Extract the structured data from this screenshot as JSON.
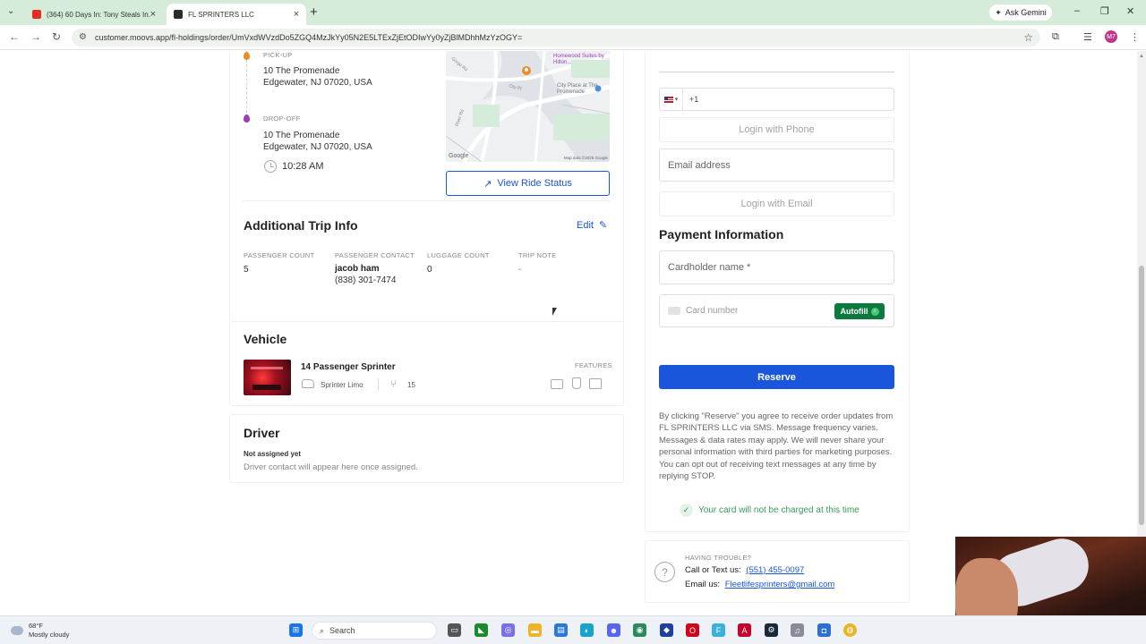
{
  "browser": {
    "tabs": [
      {
        "title": "(364) 60 Days In: Tony Steals In...",
        "active": false,
        "favicon_color": "#e52d27"
      },
      {
        "title": "FL SPRINTERS LLC",
        "active": true,
        "favicon_color": "#2b2b2b"
      }
    ],
    "gemini_label": "Ask Gemini",
    "url": "customer.moovs.app/fl-holdings/order/UmVxdWVzdDo5ZGQ4MzJkYy05N2E5LTExZjEtODIwYy0yZjBlMDhhMzYzOGY=",
    "profile_initials": "M7"
  },
  "trip": {
    "pickup_label": "PICK-UP",
    "pickup_address_line1": "10 The Promenade",
    "pickup_address_line2": "Edgewater, NJ 07020, USA",
    "dropoff_label": "DROP-OFF",
    "dropoff_address_line1": "10 The Promenade",
    "dropoff_address_line2": "Edgewater, NJ 07020, USA",
    "time": "10:28 AM",
    "view_ride_status": "View Ride Status",
    "map_labels": {
      "hotel": "Homewood Suites by Hilton...",
      "plaza": "City Place at The Promenade",
      "road1": "River Rd",
      "road2": "City Pl",
      "road3": "Gorge Rd",
      "google": "Google",
      "map_data": "Map data ©2025 Google"
    }
  },
  "additional_info": {
    "title": "Additional Trip Info",
    "edit_label": "Edit",
    "passenger_count_label": "PASSENGER COUNT",
    "passenger_count": "5",
    "passenger_contact_label": "PASSENGER CONTACT",
    "passenger_name": "jacob ham",
    "passenger_phone": "(838) 301-7474",
    "luggage_count_label": "LUGGAGE COUNT",
    "luggage_count": "0",
    "trip_note_label": "TRIP NOTE",
    "trip_note": "-"
  },
  "vehicle": {
    "title": "Vehicle",
    "name": "14 Passenger Sprinter",
    "type": "Sprinter Limo",
    "capacity": "15",
    "features_label": "FEATURES"
  },
  "driver": {
    "title": "Driver",
    "status": "Not assigned yet",
    "note": "Driver contact will appear here once assigned."
  },
  "login": {
    "country_code": "+1",
    "login_phone": "Login with Phone",
    "email_placeholder": "Email address",
    "login_email": "Login with Email"
  },
  "payment": {
    "title": "Payment Information",
    "cardholder_placeholder": "Cardholder name *",
    "card_placeholder": "Card number",
    "autofill_label": "Autofill",
    "reserve_label": "Reserve",
    "legal_text": "By clicking \"Reserve\" you agree to receive order updates from FL SPRINTERS LLC via SMS. Message frequency varies. Messages & data rates may apply. We will never share your personal information with third parties for marketing purposes. You can opt out of receiving text messages at any time by replying STOP.",
    "not_charged": "Your card will not be charged at this time"
  },
  "help": {
    "trouble_label": "HAVING TROUBLE?",
    "call_label": "Call or Text us:",
    "phone": "(551) 455-0097",
    "email_label": "Email us:",
    "email": "Fleetlifesprinters@gmail.com"
  },
  "taskbar": {
    "temperature": "68°F",
    "weather": "Mostly cloudy",
    "search_placeholder": "Search"
  },
  "colors": {
    "accent": "#1a56db",
    "pickup_pin": "#f08a24",
    "dropoff_pin": "#9b3fb5",
    "autofill": "#0c7a3f",
    "success": "#3a9a5a"
  }
}
